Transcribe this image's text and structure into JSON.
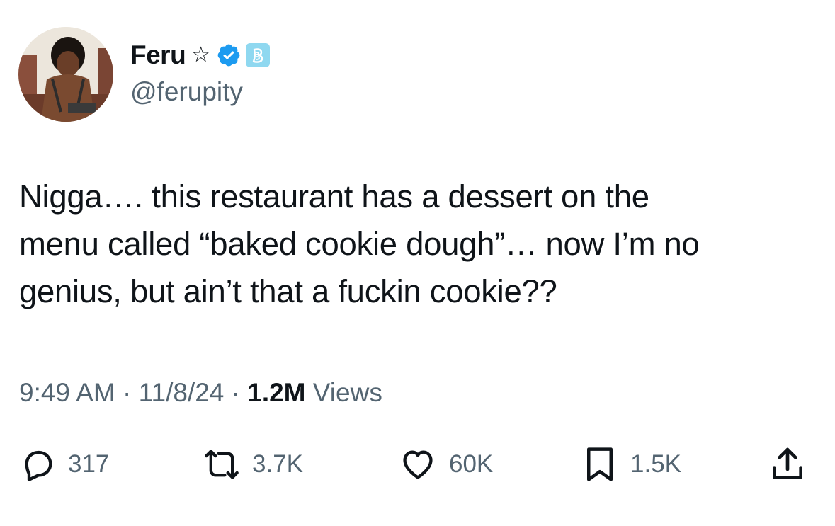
{
  "author": {
    "display_name": "Feru",
    "star_glyph": "☆",
    "handle": "@ferupity",
    "verified_color": "#1d9bf0",
    "affiliate_badge_color": "#8fd8f0"
  },
  "tweet": {
    "lines": [
      "Nigga…. this restaurant has a dessert on the",
      "menu called “baked cookie dough”… now I’m no",
      "genius, but ain’t that a fuckin cookie??"
    ]
  },
  "meta": {
    "time": "9:49 AM",
    "separator": "·",
    "date": "11/8/24",
    "views_count": "1.2M",
    "views_label": "Views"
  },
  "actions": {
    "replies": "317",
    "reposts": "3.7K",
    "likes": "60K",
    "bookmarks": "1.5K"
  },
  "colors": {
    "text": "#0f1419",
    "secondary": "#536471"
  }
}
